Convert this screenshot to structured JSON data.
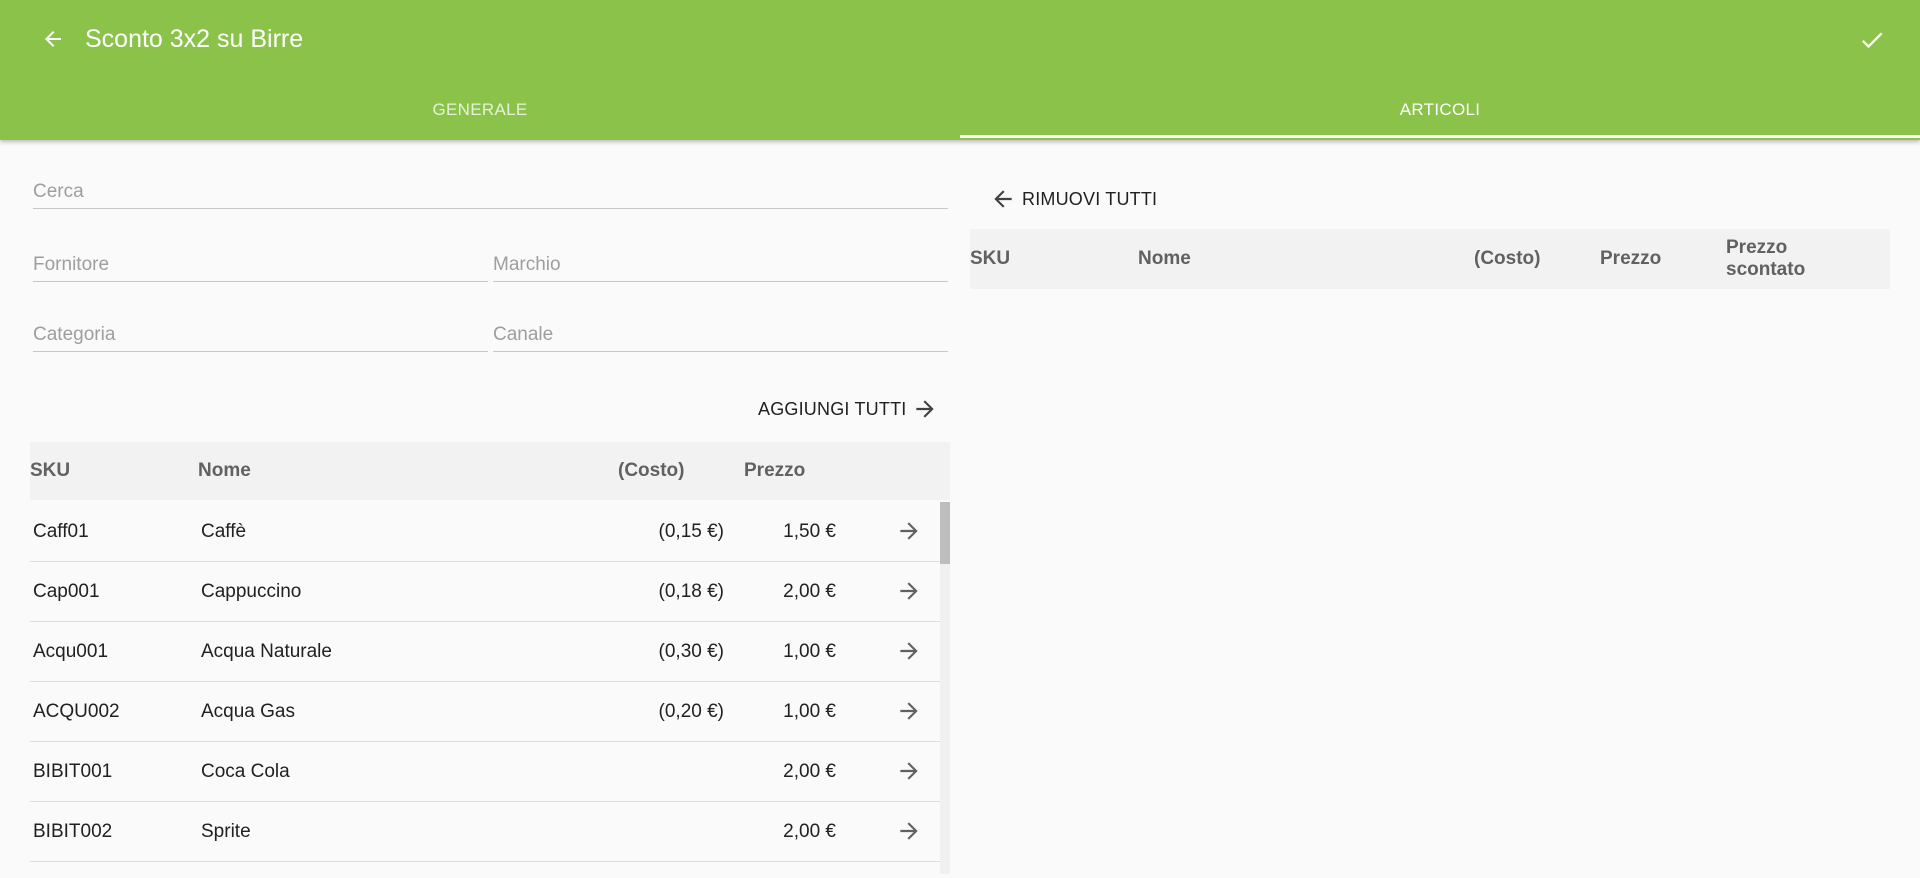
{
  "header": {
    "title": "Sconto 3x2 su Birre",
    "back_icon": "arrow-left-icon",
    "confirm_icon": "check-icon",
    "color": "#8bc34a"
  },
  "tabs": [
    {
      "label": "GENERALE",
      "active": false
    },
    {
      "label": "ARTICOLI",
      "active": true
    }
  ],
  "filters": {
    "search": {
      "placeholder": "Cerca",
      "value": ""
    },
    "supplier": {
      "placeholder": "Fornitore",
      "value": ""
    },
    "brand": {
      "placeholder": "Marchio",
      "value": ""
    },
    "category": {
      "placeholder": "Categoria",
      "value": ""
    },
    "channel": {
      "placeholder": "Canale",
      "value": ""
    }
  },
  "available": {
    "add_all_label": "AGGIUNGI TUTTI",
    "columns": {
      "sku": "SKU",
      "name": "Nome",
      "cost": "(Costo)",
      "price": "Prezzo"
    },
    "rows": [
      {
        "sku": "Caff01",
        "name": "Caffè",
        "cost": "(0,15 €)",
        "price": "1,50 €"
      },
      {
        "sku": "Cap001",
        "name": "Cappuccino",
        "cost": "(0,18 €)",
        "price": "2,00 €"
      },
      {
        "sku": "Acqu001",
        "name": "Acqua Naturale",
        "cost": "(0,30 €)",
        "price": "1,00 €"
      },
      {
        "sku": "ACQU002",
        "name": "Acqua Gas",
        "cost": "(0,20 €)",
        "price": "1,00 €"
      },
      {
        "sku": "BIBIT001",
        "name": "Coca Cola",
        "cost": "",
        "price": "2,00 €"
      },
      {
        "sku": "BIBIT002",
        "name": "Sprite",
        "cost": "",
        "price": "2,00 €"
      }
    ]
  },
  "selected": {
    "remove_all_label": "RIMUOVI TUTTI",
    "columns": {
      "sku": "SKU",
      "name": "Nome",
      "cost": "(Costo)",
      "price": "Prezzo",
      "discounted_price": "Prezzo scontato"
    },
    "rows": []
  }
}
